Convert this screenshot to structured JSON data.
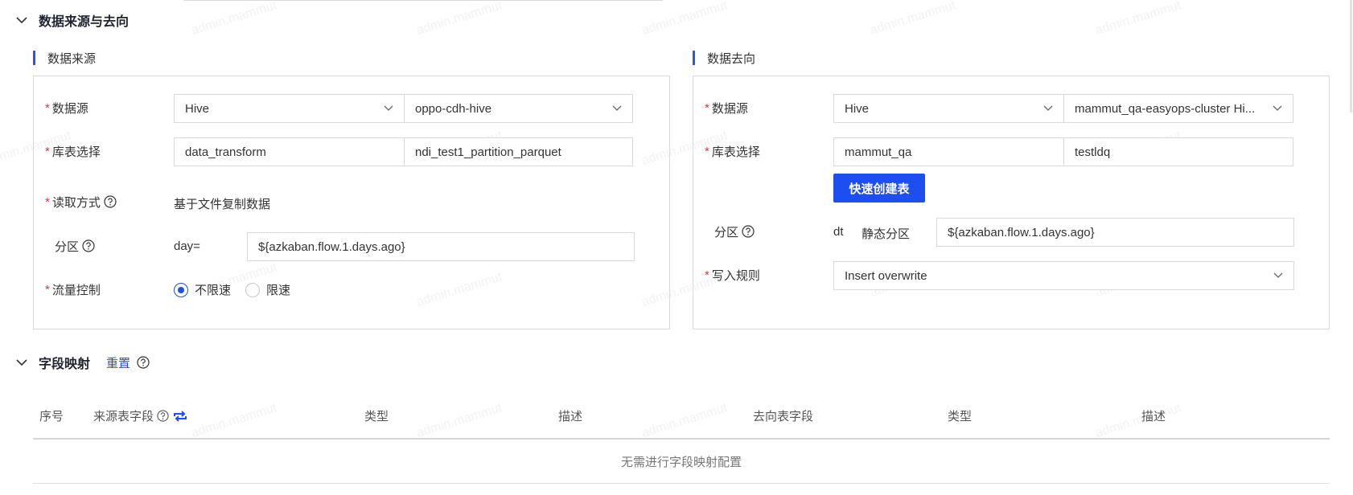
{
  "section_source_target": {
    "title": "数据来源与去向"
  },
  "source": {
    "title": "数据来源",
    "datasource": {
      "label": "数据源",
      "type": "Hive",
      "cluster": "oppo-cdh-hive"
    },
    "table_select": {
      "label": "库表选择",
      "database": "data_transform",
      "table": "ndi_test1_partition_parquet"
    },
    "read_mode": {
      "label": "读取方式",
      "value": "基于文件复制数据"
    },
    "partition": {
      "label": "分区",
      "key": "day=",
      "value": "${azkaban.flow.1.days.ago}"
    },
    "flow_control": {
      "label": "流量控制",
      "options": [
        "不限速",
        "限速"
      ],
      "selected": "不限速"
    }
  },
  "target": {
    "title": "数据去向",
    "datasource": {
      "label": "数据源",
      "type": "Hive",
      "cluster": "mammut_qa-easyops-cluster Hi..."
    },
    "table_select": {
      "label": "库表选择",
      "database": "mammut_qa",
      "table": "testldq"
    },
    "quick_create_button": "快速创建表",
    "partition": {
      "label": "分区",
      "key": "dt",
      "mode": "静态分区",
      "value": "${azkaban.flow.1.days.ago}"
    },
    "write_rule": {
      "label": "写入规则",
      "value": "Insert overwrite"
    }
  },
  "field_mapping": {
    "title": "字段映射",
    "reset_label": "重置",
    "columns": [
      "序号",
      "来源表字段",
      "类型",
      "描述",
      "去向表字段",
      "类型",
      "描述"
    ],
    "empty_text": "无需进行字段映射配置"
  },
  "watermark": "admin.mammut",
  "colors": {
    "primary": "#1d4ff0",
    "required": "#e5323f",
    "border": "#d9d9d9"
  }
}
